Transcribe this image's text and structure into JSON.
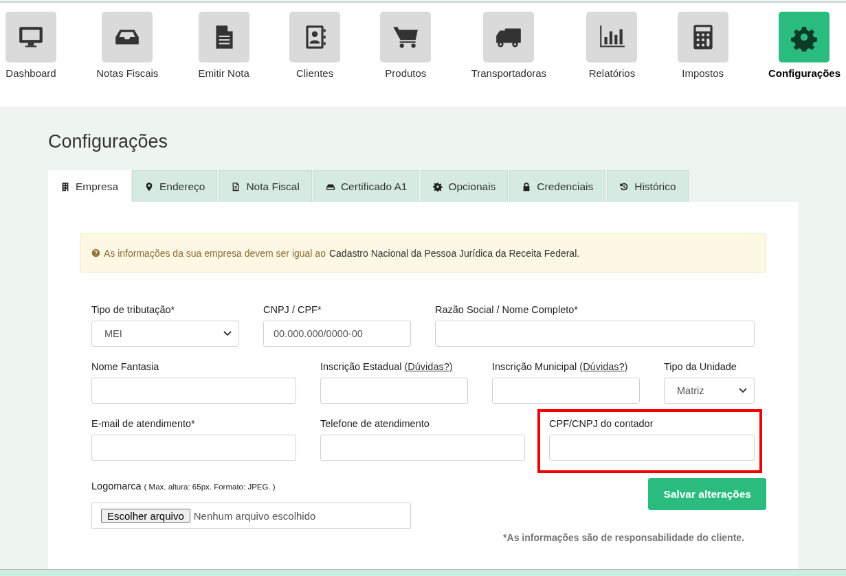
{
  "nav": [
    {
      "label": "Dashboard",
      "kind": "monitor",
      "selected": false
    },
    {
      "label": "Notas Fiscais",
      "kind": "inbox",
      "selected": false
    },
    {
      "label": "Emitir Nota",
      "kind": "document",
      "selected": false
    },
    {
      "label": "Clientes",
      "kind": "contacts",
      "selected": false
    },
    {
      "label": "Produtos",
      "kind": "cart",
      "selected": false
    },
    {
      "label": "Transportadoras",
      "kind": "truck",
      "selected": false
    },
    {
      "label": "Relatórios",
      "kind": "chart",
      "selected": false
    },
    {
      "label": "Impostos",
      "kind": "calculator",
      "selected": false
    },
    {
      "label": "Configurações",
      "kind": "gear",
      "selected": true
    }
  ],
  "page_title": "Configurações",
  "tabs": [
    {
      "label": "Empresa",
      "kind": "building",
      "selected": true
    },
    {
      "label": "Endereço",
      "kind": "marker",
      "selected": false
    },
    {
      "label": "Nota Fiscal",
      "kind": "document",
      "selected": false
    },
    {
      "label": "Certificado A1",
      "kind": "drive",
      "selected": false
    },
    {
      "label": "Opcionais",
      "kind": "gear",
      "selected": false
    },
    {
      "label": "Credenciais",
      "kind": "lock",
      "selected": false
    },
    {
      "label": "Histórico",
      "kind": "history",
      "selected": false
    }
  ],
  "alert": {
    "text": "As informações da sua empresa devem ser igual ao",
    "emphasis": "Cadastro Nacional da Pessoa Jurídica da Receita Federal."
  },
  "form_rows": [
    [
      {
        "label": "Tipo de tributação*",
        "kind": "select",
        "value": "MEI"
      },
      {
        "label": "CNPJ / CPF*",
        "kind": "input",
        "placeholder": "00.000.000/0000-00"
      },
      {
        "label": "Razão Social / Nome Completo*",
        "kind": "input"
      }
    ],
    [
      {
        "label": "Nome Fantasia",
        "kind": "input"
      },
      {
        "label": "Inscrição Estadual",
        "help_link": "(Dúvidas?)",
        "kind": "input"
      },
      {
        "label": "Inscrição Municipal",
        "help_link": "(Dúvidas?)",
        "kind": "input"
      },
      {
        "label": "Tipo da Unidade",
        "kind": "select",
        "value": "Matriz"
      }
    ],
    [
      {
        "label": "E-mail de atendimento*",
        "kind": "input"
      },
      {
        "label": "Telefone de atendimento",
        "kind": "input"
      },
      {
        "label": "CPF/CNPJ do contador",
        "kind": "input",
        "highlighted": true
      }
    ]
  ],
  "logo": {
    "label": "Logomarca",
    "note": "( Max. altura: 65px. Formato: JPEG. )",
    "button": "Escolher arquivo",
    "status": "Nenhum arquivo escolhido"
  },
  "save_button": "Salvar alterações",
  "footnote": "*As informações são de responsabilidade do cliente."
}
